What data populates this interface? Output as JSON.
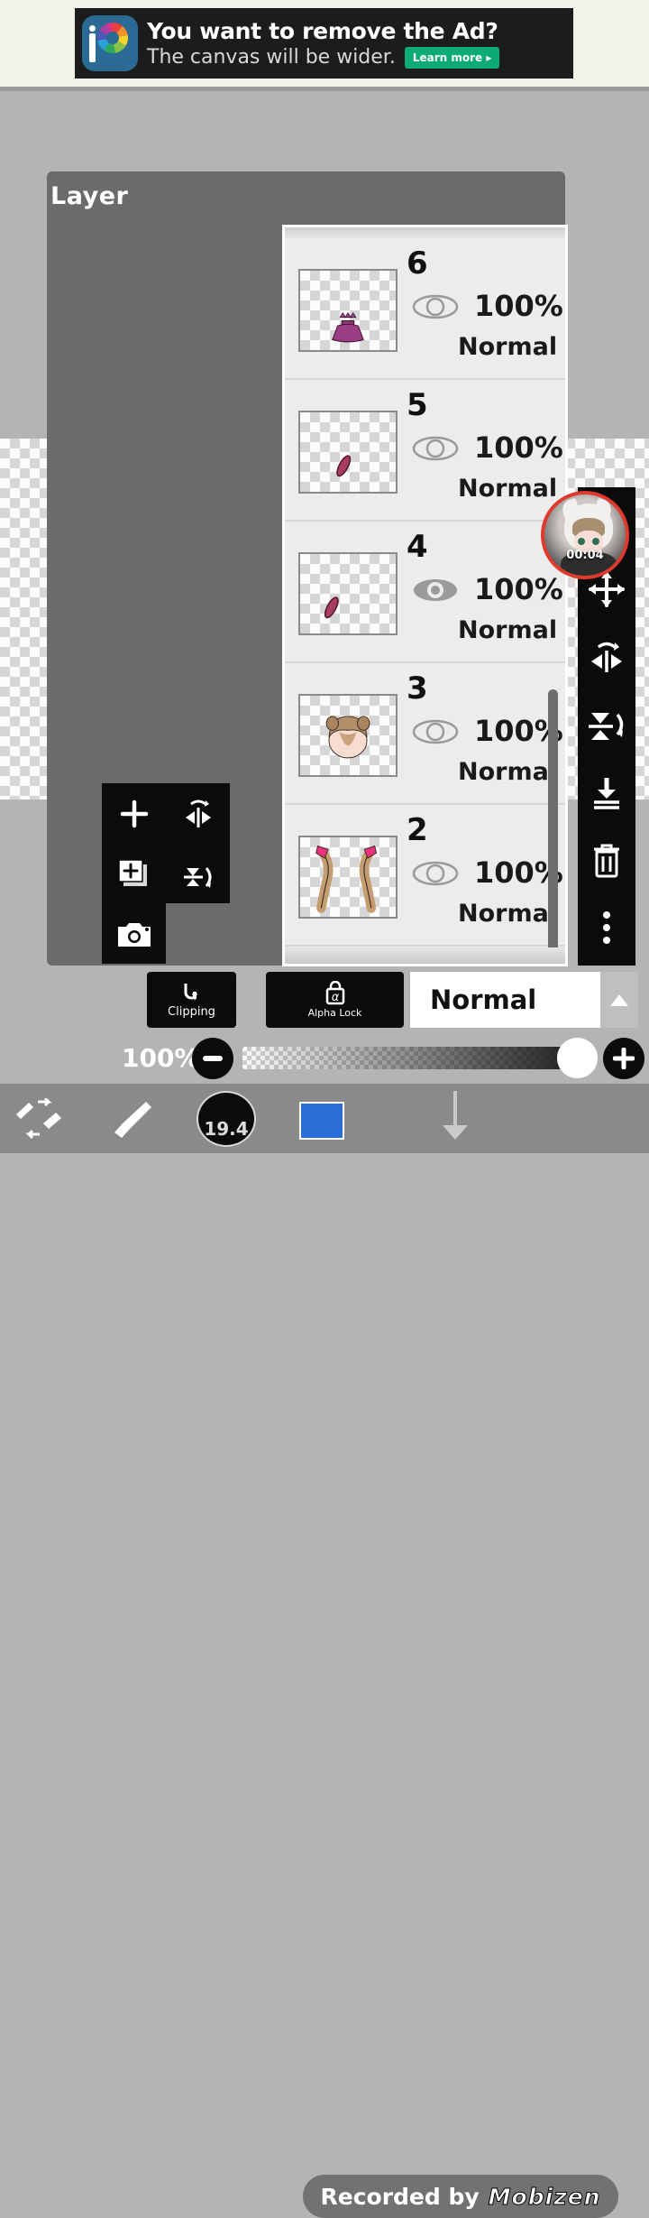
{
  "ad": {
    "headline": "You want to remove the Ad?",
    "subline": "The canvas will be wider.",
    "cta": "Learn more ▸",
    "logo_icon": "ibispaint-logo-icon"
  },
  "dialog": {
    "title": "Layer"
  },
  "layers": [
    {
      "number": "6",
      "opacity": "100%",
      "blend_mode": "Normal",
      "visible_icon": "eye-outline-icon",
      "active": false,
      "thumb": "purple-dress-sprite"
    },
    {
      "number": "5",
      "opacity": "100%",
      "blend_mode": "Normal",
      "visible_icon": "eye-outline-icon",
      "active": false,
      "thumb": "magenta-stroke-sprite"
    },
    {
      "number": "4",
      "opacity": "100%",
      "blend_mode": "Normal",
      "visible_icon": "eye-filled-icon",
      "active": true,
      "thumb": "magenta-stroke-sprite"
    },
    {
      "number": "3",
      "opacity": "100%",
      "blend_mode": "Normal",
      "visible_icon": "eye-outline-icon",
      "active": false,
      "thumb": "face-with-brown-hair-sprite"
    },
    {
      "number": "2",
      "opacity": "100%",
      "blend_mode": "Normal",
      "visible_icon": "eye-outline-icon",
      "active": false,
      "thumb": "twintail-hair-sprite"
    }
  ],
  "add_panel": {
    "buttons": [
      {
        "name": "add-layer",
        "icon": "plus-icon"
      },
      {
        "name": "flip-horizontal",
        "icon": "flip-horizontal-icon"
      },
      {
        "name": "duplicate-layer",
        "icon": "duplicate-layer-icon"
      },
      {
        "name": "flip-vertical",
        "icon": "flip-vertical-icon"
      },
      {
        "name": "camera-import",
        "icon": "camera-icon"
      }
    ]
  },
  "right_toolbar": {
    "buttons": [
      {
        "name": "snapshot",
        "icon": "snapshot-icon"
      },
      {
        "name": "move-transform",
        "icon": "move-arrows-icon"
      },
      {
        "name": "flip-horizontal",
        "icon": "flip-horizontal-icon"
      },
      {
        "name": "flip-vertical",
        "icon": "flip-vertical-icon"
      },
      {
        "name": "merge-down",
        "icon": "merge-down-icon"
      },
      {
        "name": "delete-layer",
        "icon": "trash-icon"
      },
      {
        "name": "more-options",
        "icon": "more-vertical-icon"
      }
    ]
  },
  "webcam": {
    "timer": "00:04"
  },
  "controls": {
    "clipping_label": "Clipping",
    "clipping_icon": "clipping-arrow-icon",
    "alpha_lock_label": "Alpha Lock",
    "alpha_lock_icon": "alpha-lock-icon",
    "blend_mode_value": "Normal",
    "blend_arrow_icon": "triangle-up-icon",
    "opacity_value": "100%",
    "minus_label": "−",
    "plus_label": "+"
  },
  "bottom_bar": {
    "swap_icon": "brush-eraser-swap-icon",
    "brush_icon": "paintbrush-icon",
    "brush_size": "19.4",
    "color_swatch": "#2b6fd6",
    "watermark_text": "Recorded by",
    "watermark_brand": "Mobizen",
    "download_arrow_icon": "download-arrow-icon"
  },
  "colors": {
    "ad_background": "#f3f2e6",
    "ad_banner": "#1c1c1c",
    "ad_cta": "#0cab75",
    "app_background": "#b4b4b4",
    "dialog_background": "#6b6b6b",
    "layer_list_background": "#ececea",
    "toolbar_black": "#0b0b0b",
    "webcam_ring": "#e03a2f",
    "bottom_bar": "#8a8a8a"
  }
}
